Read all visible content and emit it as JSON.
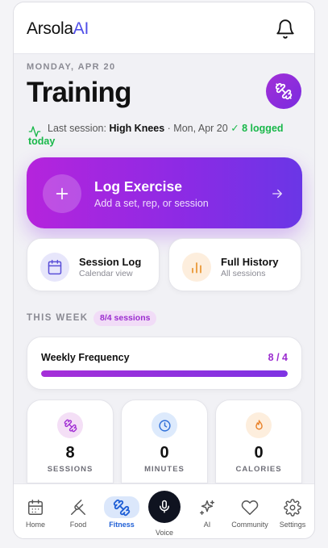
{
  "app": {
    "brand_main": "Arsola",
    "brand_accent": "AI"
  },
  "header": {
    "bell_icon": "bell-icon"
  },
  "page": {
    "date": "MONDAY, APR 20",
    "title": "Training",
    "badge_icon": "dumbbell-icon"
  },
  "last_session": {
    "prefix": "Last session: ",
    "exercise": "High Knees",
    "date": " · Mon, Apr 20 ",
    "logged": "✓ 8 logged",
    "today": "today"
  },
  "log_button": {
    "title": "Log Exercise",
    "subtitle": "Add a set, rep, or session",
    "icon": "plus-icon"
  },
  "quick_actions": [
    {
      "title": "Session Log",
      "subtitle": "Calendar view",
      "icon": "calendar-icon"
    },
    {
      "title": "Full History",
      "subtitle": "All sessions",
      "icon": "bar-chart-icon"
    }
  ],
  "week": {
    "heading": "THIS WEEK",
    "pill": "8/4 sessions",
    "frequency_label": "Weekly Frequency",
    "frequency_value": "8 / 4",
    "frequency_fill": 1.0
  },
  "stats": [
    {
      "value": "8",
      "label": "SESSIONS",
      "icon": "dumbbell-icon"
    },
    {
      "value": "0",
      "label": "MINUTES",
      "icon": "clock-icon"
    },
    {
      "value": "0",
      "label": "CALORIES",
      "icon": "flame-icon"
    }
  ],
  "nav": [
    {
      "label": "Home",
      "icon": "calendar-icon"
    },
    {
      "label": "Food",
      "icon": "fork-knife-icon"
    },
    {
      "label": "Fitness",
      "icon": "dumbbell-icon",
      "active": true
    },
    {
      "label": "Voice",
      "icon": "microphone-icon"
    },
    {
      "label": "AI",
      "icon": "sparkles-icon"
    },
    {
      "label": "Community",
      "icon": "heart-icon"
    },
    {
      "label": "Settings",
      "icon": "gear-icon"
    }
  ],
  "colors": {
    "accent": "#9b2ccf",
    "brand_ai": "#4f4ee8",
    "success": "#19b84a",
    "nav_active": "#1f5fd6"
  }
}
